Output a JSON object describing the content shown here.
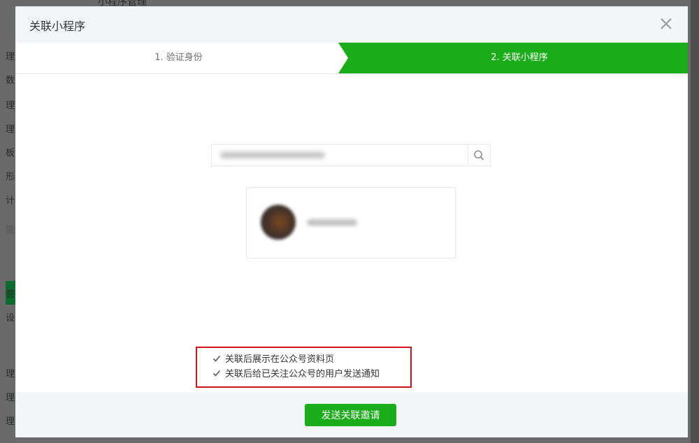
{
  "background": {
    "top_note": "小程序管理",
    "sidebar_chars": [
      "理",
      "数",
      "理",
      "理",
      "板",
      "形",
      "计",
      "能",
      "管",
      "设",
      "理",
      "理",
      "理"
    ]
  },
  "modal": {
    "title": "关联小程序",
    "close_icon": "close-icon"
  },
  "steps": {
    "step1_label": "1. 验证身份",
    "step2_label": "2. 关联小程序",
    "active_color": "#1aad19"
  },
  "search": {
    "icon": "search-icon"
  },
  "options": {
    "show_on_profile_label": "关联后展示在公众号资料页",
    "show_on_profile_checked": true,
    "notify_followers_label": "关联后给已关注公众号的用户发送通知",
    "notify_followers_checked": true
  },
  "footer": {
    "send_invite_label": "发送关联邀请"
  },
  "colors": {
    "primary": "#1aad19",
    "highlight_border": "#d0121b"
  }
}
